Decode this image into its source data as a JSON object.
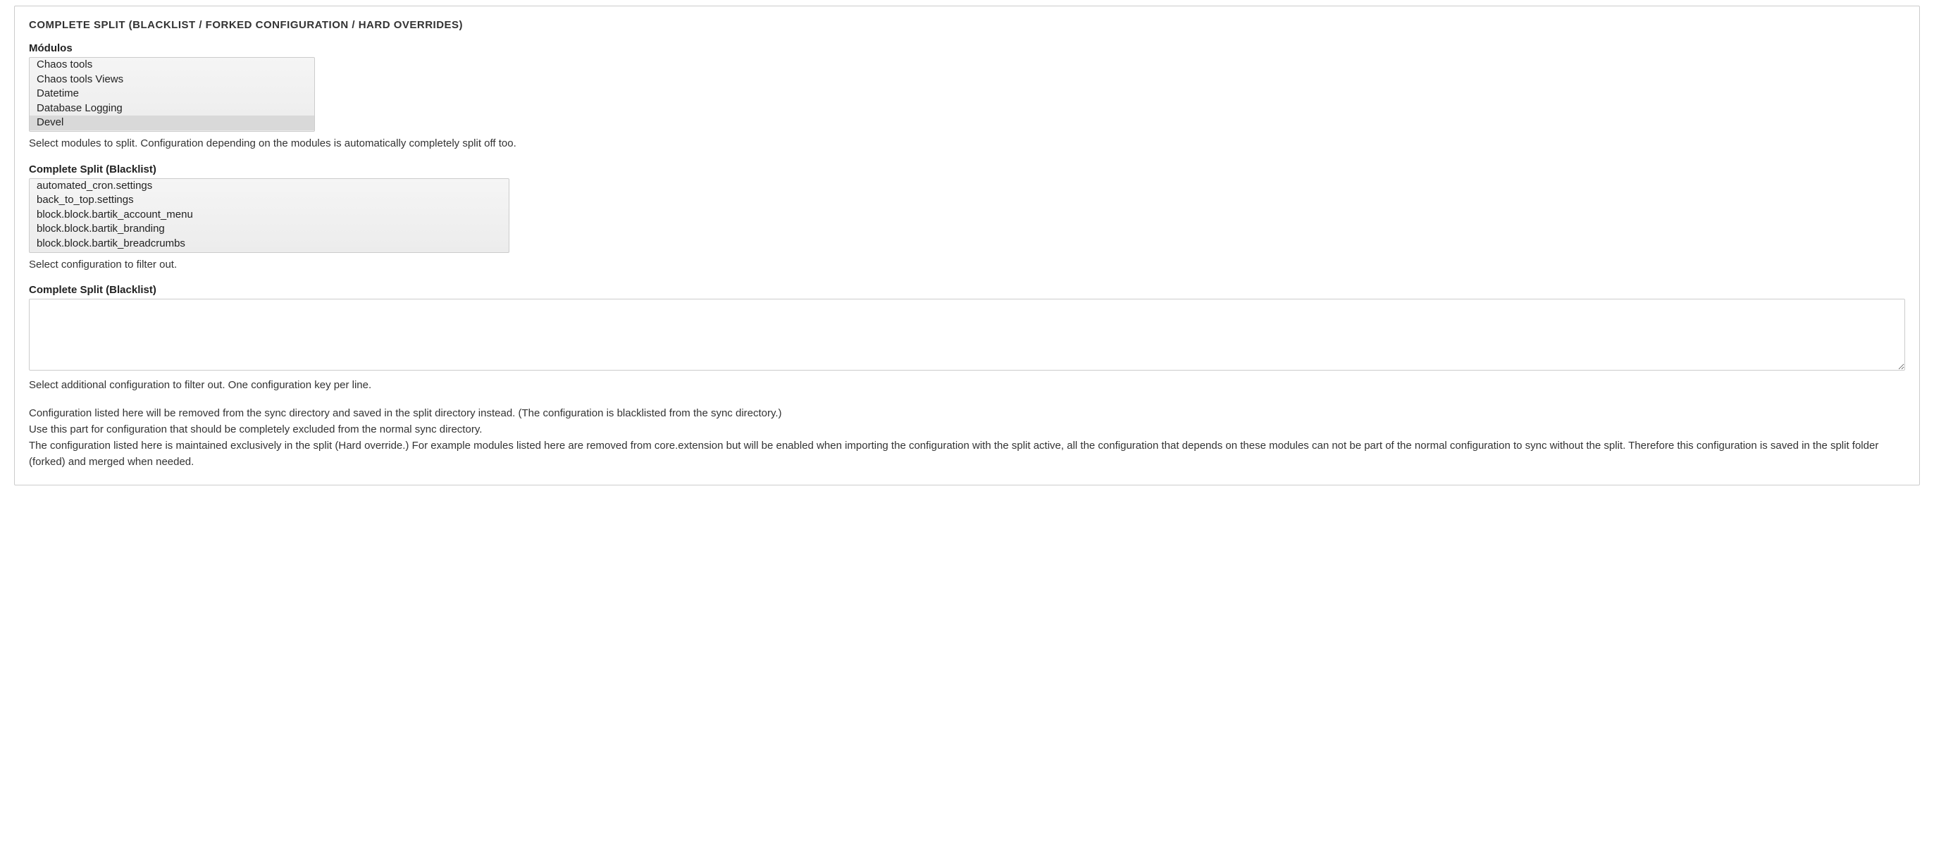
{
  "fieldset": {
    "legend": "COMPLETE SPLIT (BLACKLIST / FORKED CONFIGURATION / HARD OVERRIDES)"
  },
  "modules": {
    "label": "Módulos",
    "options": [
      {
        "label": "Chaos tools",
        "selected": false
      },
      {
        "label": "Chaos tools Views",
        "selected": false
      },
      {
        "label": "Datetime",
        "selected": false
      },
      {
        "label": "Database Logging",
        "selected": false
      },
      {
        "label": "Devel",
        "selected": true
      }
    ],
    "description": "Select modules to split. Configuration depending on the modules is automatically completely split off too."
  },
  "blacklist_config": {
    "label": "Complete Split (Blacklist)",
    "options": [
      {
        "label": "automated_cron.settings",
        "selected": false
      },
      {
        "label": "back_to_top.settings",
        "selected": false
      },
      {
        "label": "block.block.bartik_account_menu",
        "selected": false
      },
      {
        "label": "block.block.bartik_branding",
        "selected": false
      },
      {
        "label": "block.block.bartik_breadcrumbs",
        "selected": false
      }
    ],
    "description": "Select configuration to filter out."
  },
  "blacklist_text": {
    "label": "Complete Split (Blacklist)",
    "value": "",
    "description": "Select additional configuration to filter out. One configuration key per line."
  },
  "help": {
    "line1": "Configuration listed here will be removed from the sync directory and saved in the split directory instead. (The configuration is blacklisted from the sync directory.)",
    "line2": "Use this part for configuration that should be completely excluded from the normal sync directory.",
    "line3": "The configuration listed here is maintained exclusively in the split (Hard override.) For example modules listed here are removed from core.extension but will be enabled when importing the configuration with the split active, all the configuration that depends on these modules can not be part of the normal configuration to sync without the split. Therefore this configuration is saved in the split folder (forked) and merged when needed."
  }
}
